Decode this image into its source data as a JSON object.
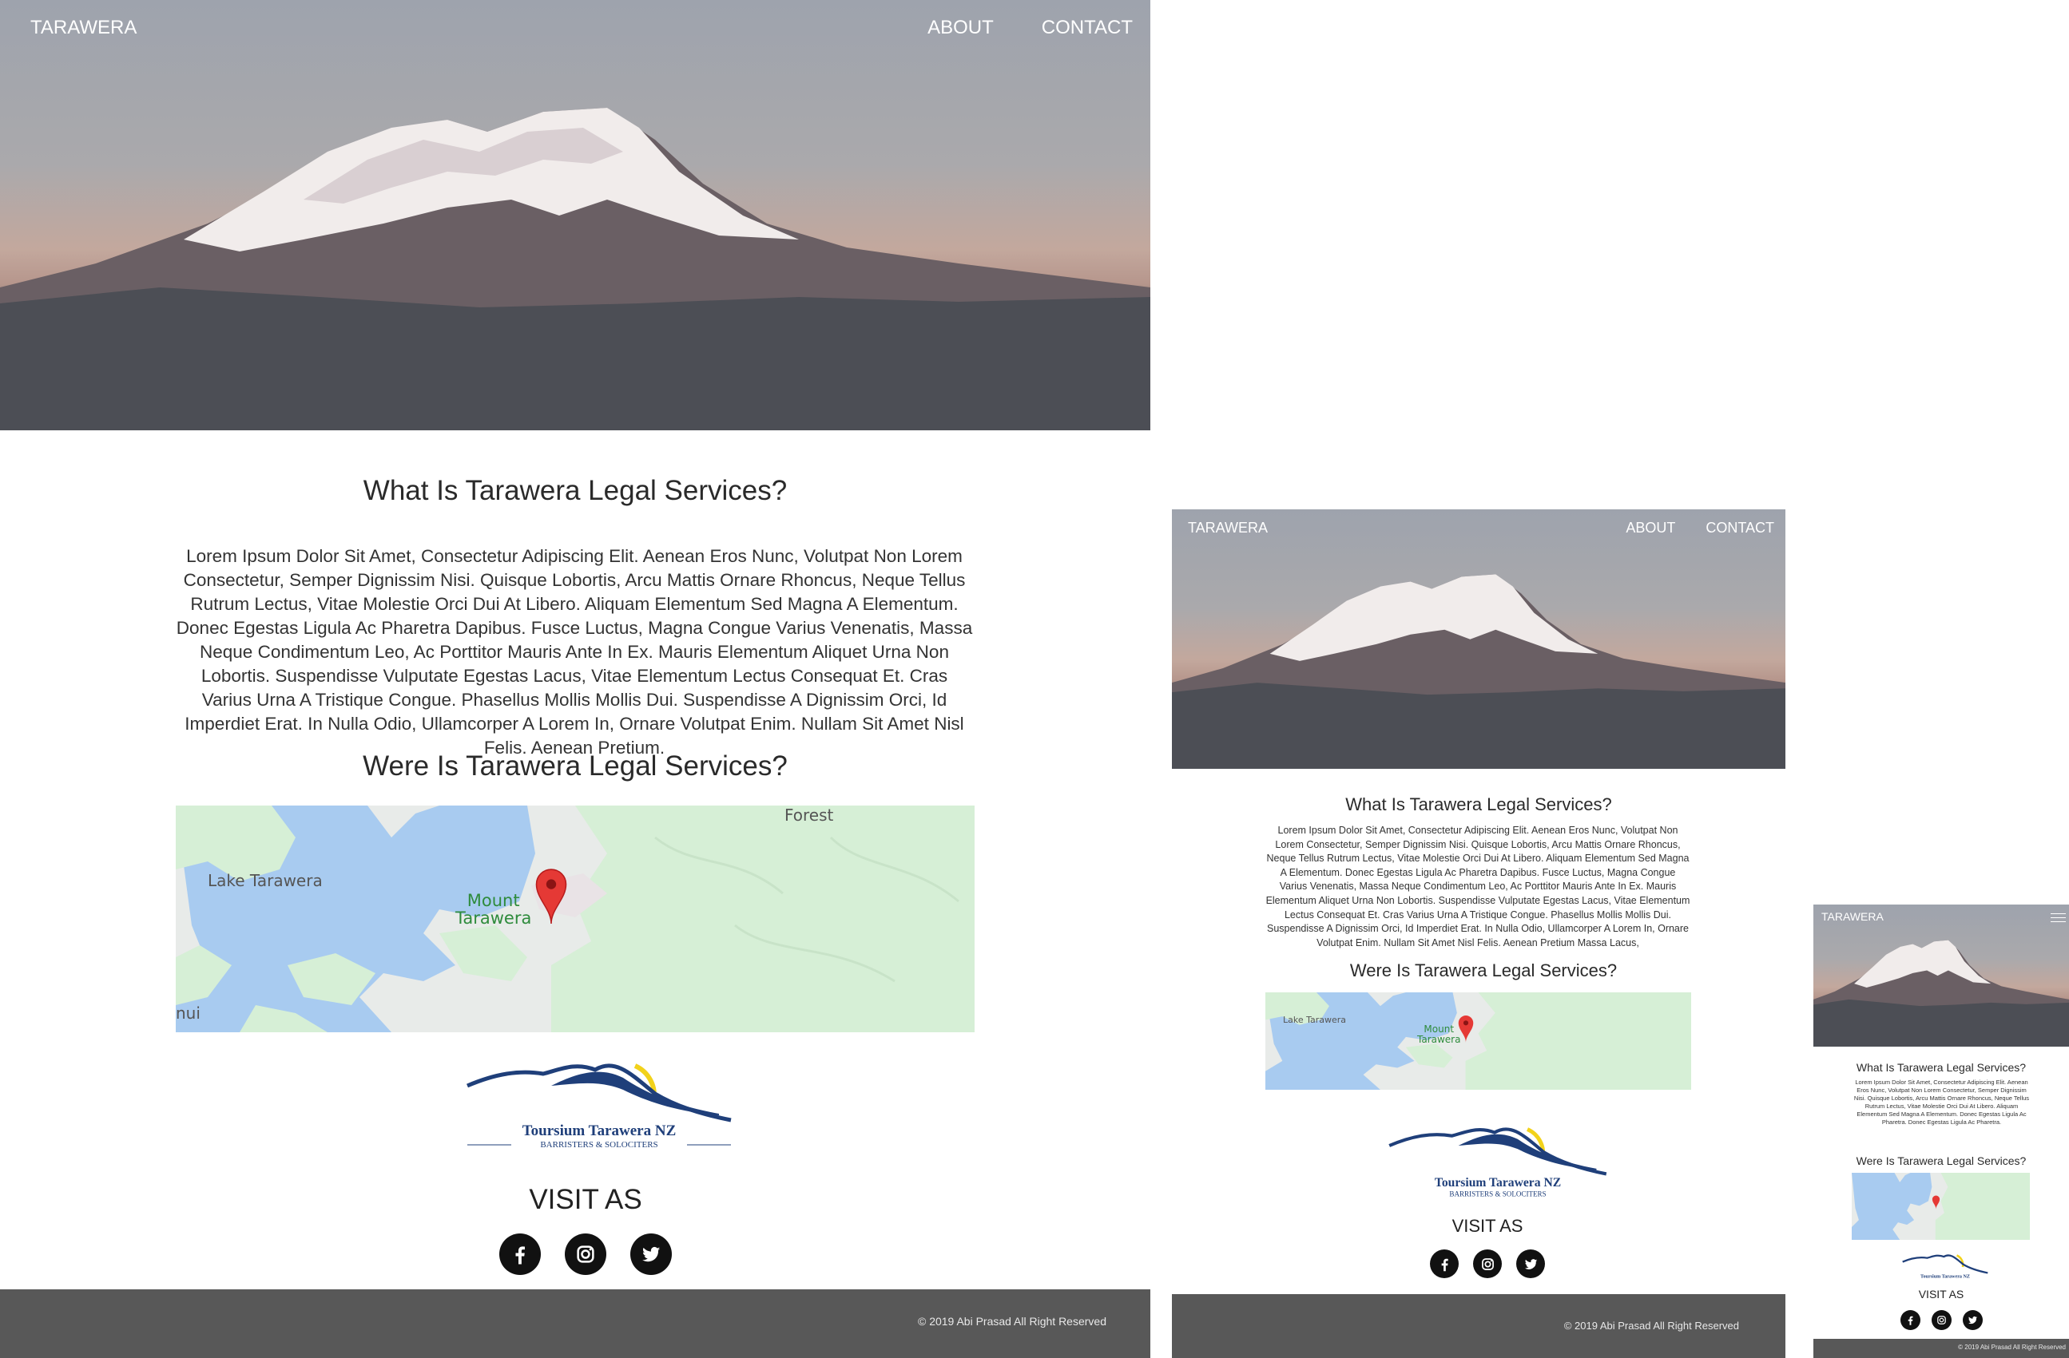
{
  "site": {
    "brand": "TARAWERA",
    "nav": {
      "about": "ABOUT",
      "contact": "CONTACT"
    },
    "section1_title": "What Is Tarawera Legal Services?",
    "section1_text": "Lorem Ipsum Dolor Sit Amet, Consectetur Adipiscing Elit. Aenean Eros Nunc, Volutpat Non Lorem Consectetur, Semper Dignissim Nisi. Quisque Lobortis, Arcu Mattis Ornare Rhoncus, Neque Tellus Rutrum Lectus, Vitae Molestie Orci Dui At Libero. Aliquam Elementum Sed Magna A Elementum. Donec Egestas Ligula Ac Pharetra Dapibus. Fusce Luctus, Magna Congue Varius Venenatis, Massa Neque Condimentum Leo, Ac Porttitor Mauris Ante In Ex. Mauris Elementum Aliquet Urna Non Lobortis. Suspendisse Vulputate Egestas Lacus, Vitae Elementum Lectus Consequat Et. Cras Varius Urna A Tristique Congue. Phasellus Mollis Mollis Dui. Suspendisse A Dignissim Orci, Id Imperdiet Erat. In Nulla Odio, Ullamcorper A Lorem In, Ornare Volutpat Enim. Nullam Sit Amet Nisl Felis. Aenean Pretium.",
    "section1_text_medium": "Lorem Ipsum Dolor Sit Amet, Consectetur Adipiscing Elit. Aenean Eros Nunc, Volutpat Non Lorem Consectetur, Semper Dignissim Nisi. Quisque Lobortis, Arcu Mattis Ornare Rhoncus, Neque Tellus Rutrum Lectus, Vitae Molestie Orci Dui At Libero. Aliquam Elementum Sed Magna A Elementum. Donec Egestas Ligula Ac Pharetra Dapibus. Fusce Luctus, Magna Congue Varius Venenatis, Massa Neque Condimentum Leo, Ac Porttitor Mauris Ante In Ex. Mauris Elementum Aliquet Urna Non Lobortis. Suspendisse Vulputate Egestas Lacus, Vitae Elementum Lectus Consequat Et. Cras Varius Urna A Tristique Congue. Phasellus Mollis Mollis Dui. Suspendisse A Dignissim Orci, Id Imperdiet Erat. In Nulla Odio, Ullamcorper A Lorem In, Ornare Volutpat Enim. Nullam Sit Amet Nisl Felis. Aenean Pretium Massa Lacus,",
    "section1_text_small": "Lorem Ipsum Dolor Sit Amet, Consectetur Adipiscing Elit. Aenean Eros Nunc, Volutpat Non Lorem Consectetur, Semper Dignissim Nisi. Quisque Lobortis, Arcu Mattis Ornare Rhoncus, Neque Tellus Rutrum Lectus, Vitae Molestie Orci Dui At Libero. Aliquam Elementum Sed Magna A Elementum. Donec Egestas Ligula Ac Pharetra. Donec Egestas Ligula Ac Pharetra.",
    "section2_title": "Were Is Tarawera Legal Services?",
    "map": {
      "lake": "Lake Tarawera",
      "mount": "Mount Tarawera",
      "mount_line1": "Mount",
      "mount_line2": "Tarawera",
      "forest": "Forest",
      "edge": "nui"
    },
    "logo": {
      "line1": "Toursium Tarawera NZ",
      "line2": "BARRISTERS & SOLOCITERS"
    },
    "visit": "VISIT AS",
    "social": [
      "facebook-icon",
      "instagram-icon",
      "twitter-icon"
    ],
    "footer": "© 2019 Abi Prasad All Right Reserved",
    "colors": {
      "footer_bg": "#585858",
      "logo_blue": "#1f3f7a",
      "logo_sun": "#f2d21b",
      "pin_red": "#e53935",
      "water": "#a8cbf0"
    }
  }
}
